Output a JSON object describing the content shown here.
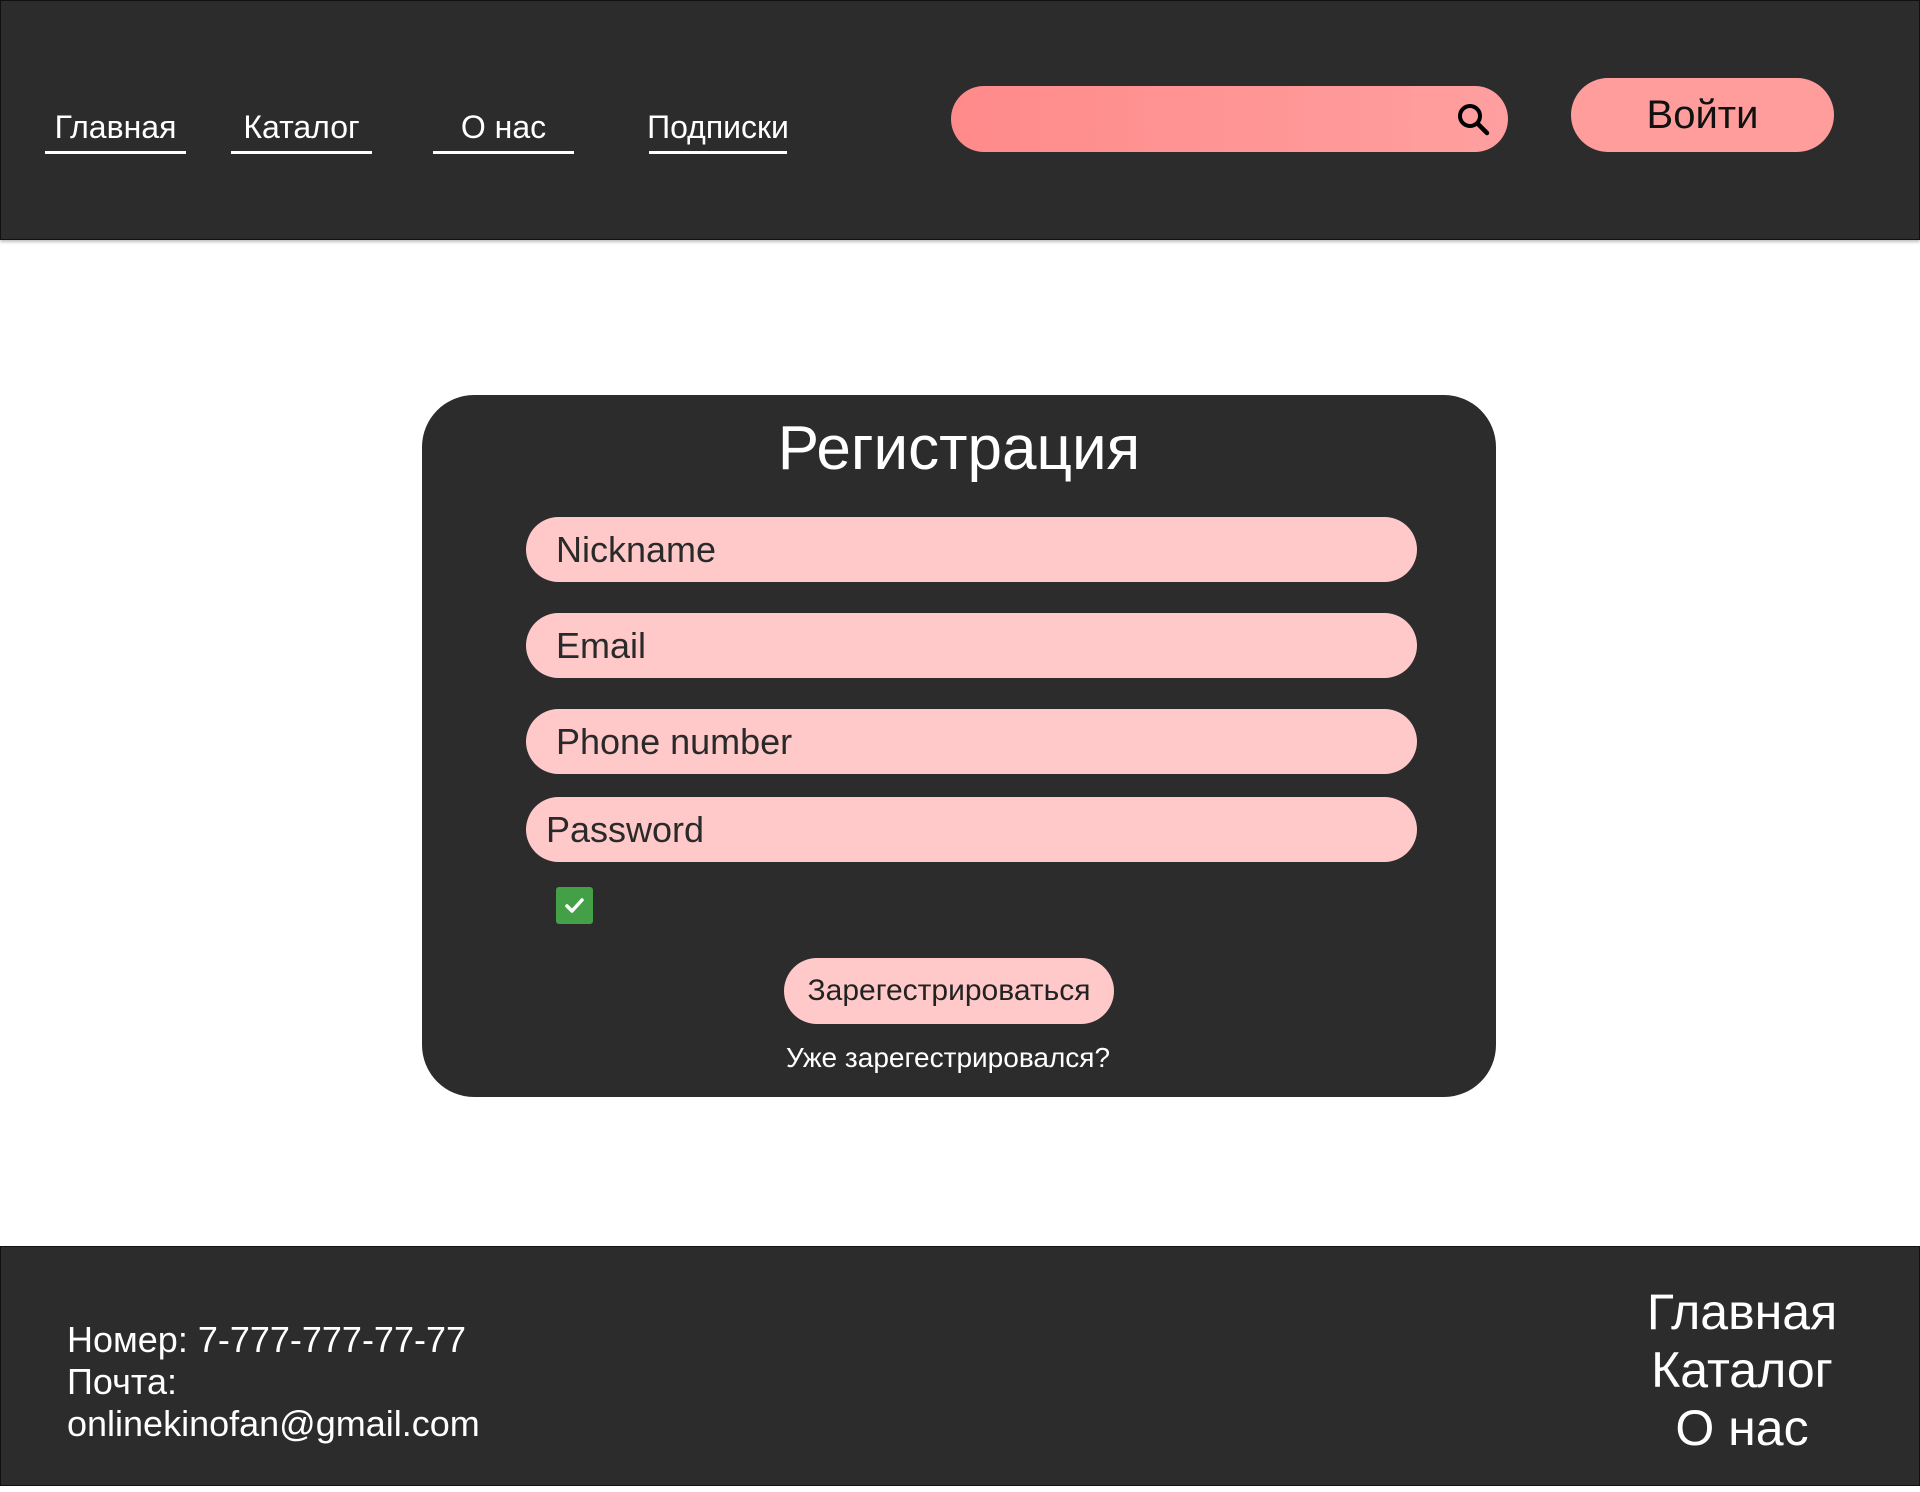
{
  "header": {
    "nav": [
      {
        "label": "Главная"
      },
      {
        "label": "Каталог"
      },
      {
        "label": "О нас"
      },
      {
        "label": "Подписки"
      }
    ],
    "search": {
      "placeholder": "",
      "value": ""
    },
    "login_label": "Войти"
  },
  "form": {
    "title": "Регистрация",
    "nickname_placeholder": "Nickname",
    "email_placeholder": "Email",
    "phone_placeholder": "Phone number",
    "password_placeholder": "Password",
    "checkbox_checked": true,
    "register_label": "Зарегестрироваться",
    "already_registered": "Уже зарегестрировался?"
  },
  "footer": {
    "phone_line": "Номер: 7-777-777-77-77",
    "email_label": "Почта:",
    "email": "onlinekinofan@gmail.com",
    "nav": [
      {
        "label": "Главная"
      },
      {
        "label": "Каталог"
      },
      {
        "label": "О нас"
      }
    ]
  },
  "colors": {
    "dark": "#2c2c2c",
    "accent_pink": "#ff9d9d",
    "field_pink": "#ffc9c9",
    "checkbox_green": "#43a047"
  },
  "icons": [
    "search-icon",
    "check-icon"
  ]
}
